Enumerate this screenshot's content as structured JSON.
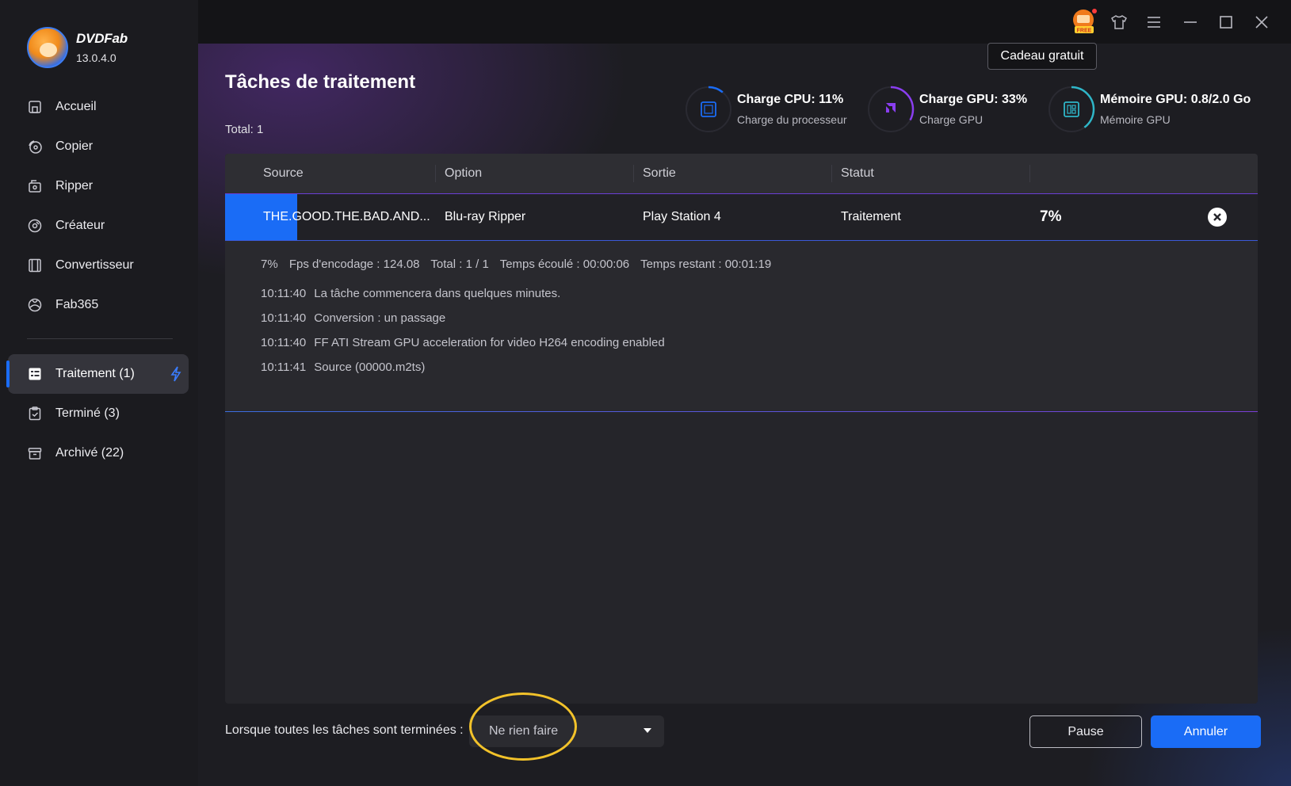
{
  "app": {
    "name": "DVDFab",
    "version": "13.0.4.0"
  },
  "sidebar": {
    "items": [
      {
        "label": "Accueil",
        "icon": "home-icon"
      },
      {
        "label": "Copier",
        "icon": "copy-disc-icon"
      },
      {
        "label": "Ripper",
        "icon": "ripper-icon"
      },
      {
        "label": "Créateur",
        "icon": "creator-disc-icon"
      },
      {
        "label": "Convertisseur",
        "icon": "film-icon"
      },
      {
        "label": "Fab365",
        "icon": "fab365-icon"
      }
    ],
    "queue": [
      {
        "label": "Traitement (1)",
        "icon": "task-list-icon",
        "active": true
      },
      {
        "label": "Terminé (3)",
        "icon": "done-clipboard-icon"
      },
      {
        "label": "Archivé (22)",
        "icon": "archive-box-icon"
      }
    ]
  },
  "topbar": {
    "free_badge": "FREE",
    "tooltip": "Cadeau gratuit"
  },
  "page": {
    "title": "Tâches de traitement",
    "total": "Total: 1"
  },
  "meters": {
    "cpu": {
      "title": "Charge CPU: 11%",
      "sub": "Charge du processeur",
      "value": 11,
      "color": "#1a6cf6"
    },
    "gpu": {
      "title": "Charge GPU: 33%",
      "sub": "Charge GPU",
      "value": 33,
      "color": "#8a3ef0"
    },
    "mem": {
      "title": "Mémoire GPU: 0.8/2.0 Go",
      "sub": "Mémoire GPU",
      "value": 40,
      "color": "#2fb6c8"
    }
  },
  "table": {
    "headers": {
      "source": "Source",
      "option": "Option",
      "output": "Sortie",
      "status": "Statut"
    },
    "row": {
      "source": "THE.GOOD.THE.BAD.AND...",
      "option": "Blu-ray Ripper",
      "output": "Play Station 4",
      "status": "Traitement",
      "percent": "7%",
      "progress": 7
    },
    "details": {
      "stats": {
        "percent": "7%",
        "fps": "Fps d'encodage : 124.08",
        "total": "Total : 1 / 1",
        "elapsed": "Temps écoulé : 00:00:06",
        "remaining": "Temps restant : 00:01:19"
      },
      "log": [
        {
          "time": "10:11:40",
          "msg": "La tâche commencera dans quelques minutes."
        },
        {
          "time": "10:11:40",
          "msg": "Conversion : un passage"
        },
        {
          "time": "10:11:40",
          "msg": "FF ATI Stream GPU acceleration for video H264 encoding enabled"
        },
        {
          "time": "10:11:41",
          "msg": "Source (00000.m2ts)"
        }
      ]
    }
  },
  "footer": {
    "label": "Lorsque toutes les tâches sont terminées :",
    "select_value": "Ne rien faire",
    "pause": "Pause",
    "cancel": "Annuler"
  }
}
